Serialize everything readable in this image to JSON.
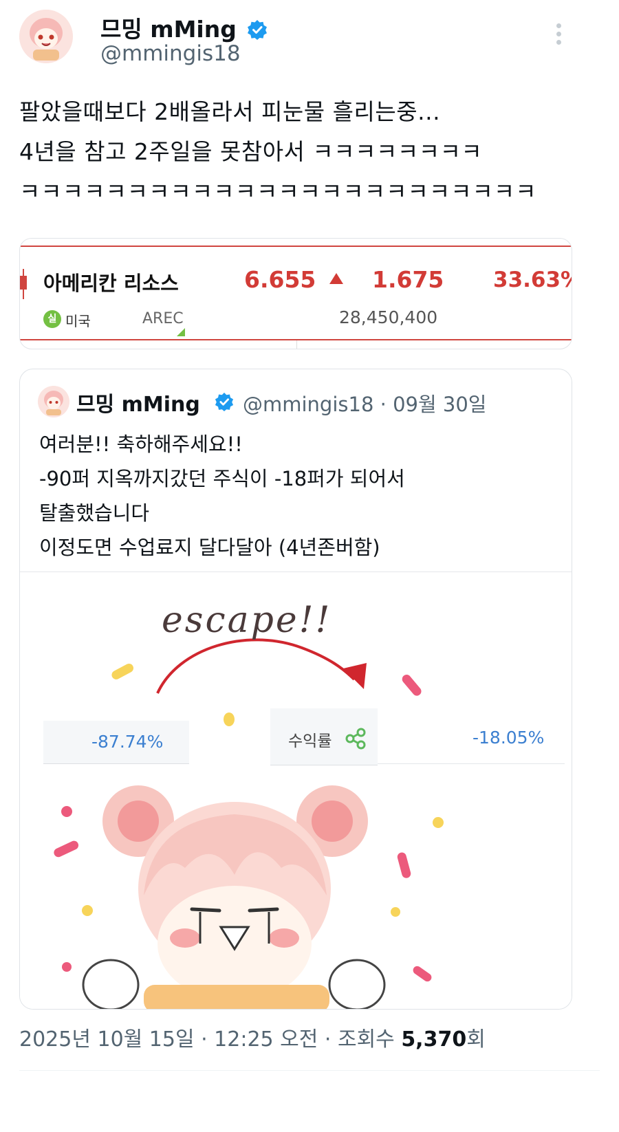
{
  "author": {
    "display_name": "므밍 mMing",
    "handle": "@mmingis18"
  },
  "tweet": {
    "lines": [
      "팔았을때보다 2배올라서 피눈물 흘리는중...",
      "4년을 참고 2주일을 못참아서 ㅋㅋㅋㅋㅋㅋㅋㅋ",
      "ㅋㅋㅋㅋㅋㅋㅋㅋㅋㅋㅋㅋㅋㅋㅋㅋㅋㅋㅋㅋㅋㅋㅋㅋ"
    ]
  },
  "stock": {
    "name": "아메리칸 리소스",
    "price": "6.655",
    "change": "1.675",
    "rate": "33.63%",
    "badge": "실",
    "country": "미국",
    "ticker": "AREC",
    "volume": "28,450,400",
    "color_up": "#d23b36"
  },
  "quote": {
    "display_name": "므밍 mMing",
    "handle_date": "@mmingis18 · 09월 30일",
    "lines": [
      "여러분!! 축하해주세요!!",
      "-90퍼 지옥까지갔던 주식이 -18퍼가 되어서",
      "탈출했습니다",
      "이정도면 수업료지 달다달아 (4년존버함)"
    ],
    "image": {
      "caption": "escape!!",
      "pct_before": "-87.74%",
      "profit_label": "수익률",
      "pct_after": "-18.05%"
    }
  },
  "footer": {
    "timestamp": "2025년 10월 15일 · 12:25 오전 · 조회수 ",
    "views": "5,370",
    "views_suffix": "회"
  },
  "colors": {
    "verified": "#1d9bf0",
    "secondary_text": "#536471",
    "percent_blue": "#3b7fd0"
  }
}
